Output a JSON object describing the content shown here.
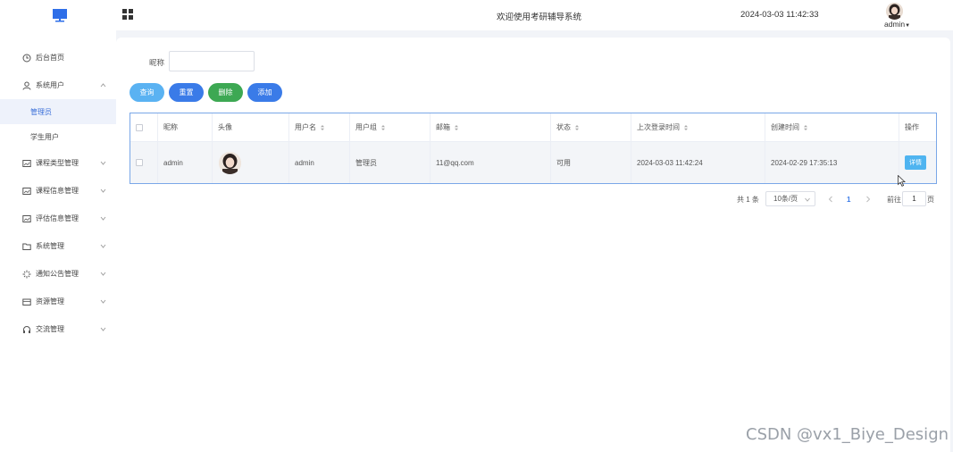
{
  "header": {
    "title": "欢迎使用考研辅导系统",
    "datetime": "2024-03-03 11:42:33",
    "user": "admin",
    "accent": "#2f6fe8"
  },
  "sidebar": {
    "items": [
      {
        "label": "后台首页",
        "icon": "clock-icon"
      },
      {
        "label": "系统用户",
        "icon": "user-icon",
        "expanded": true
      },
      {
        "label": "课程类型管理",
        "icon": "image-icon"
      },
      {
        "label": "课程信息管理",
        "icon": "image-icon"
      },
      {
        "label": "评估信息管理",
        "icon": "image-icon"
      },
      {
        "label": "系统管理",
        "icon": "folder-icon"
      },
      {
        "label": "通知公告管理",
        "icon": "sparkle-icon"
      },
      {
        "label": "资源管理",
        "icon": "box-icon"
      },
      {
        "label": "交流管理",
        "icon": "headset-icon"
      }
    ],
    "sub_items": [
      {
        "label": "管理员",
        "active": true
      },
      {
        "label": "学生用户",
        "active": false
      }
    ]
  },
  "search": {
    "label": "昵称",
    "value": ""
  },
  "buttons": {
    "query": "查询",
    "reset": "重置",
    "delete": "删除",
    "add": "添加",
    "colors": {
      "query": "#5ab2f2",
      "reset": "#3a7be8",
      "delete": "#3da853",
      "add": "#3a7be8"
    }
  },
  "table": {
    "columns": [
      "昵称",
      "头像",
      "用户名",
      "用户组",
      "邮箱",
      "状态",
      "上次登录时间",
      "创建时间",
      "操作"
    ],
    "rows": [
      {
        "nickname": "admin",
        "username": "admin",
        "group": "管理员",
        "email": "11@qq.com",
        "status": "可用",
        "last_login": "2024-03-03 11:42:24",
        "created": "2024-02-29 17:35:13",
        "action": "详情"
      }
    ]
  },
  "pagination": {
    "total": "共 1 条",
    "page_size": "10条/页",
    "current_page": "1",
    "goto_label": "前往",
    "goto_value": "1",
    "page_suffix": "页"
  },
  "watermark": "CSDN @vx1_Biye_Design"
}
